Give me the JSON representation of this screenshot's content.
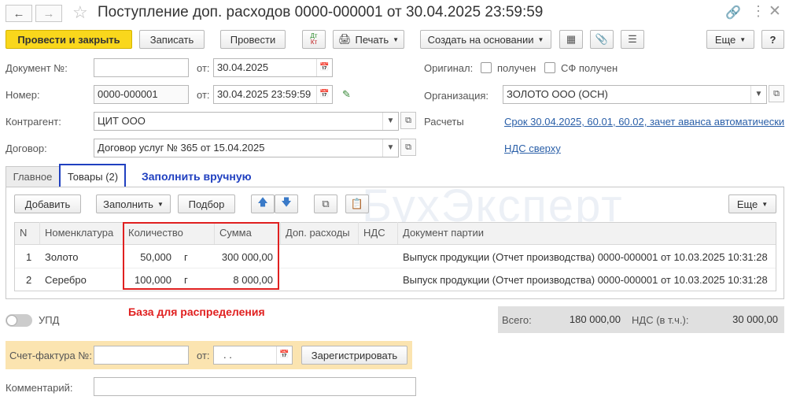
{
  "window": {
    "title": "Поступление доп. расходов 0000-000001 от 30.04.2025 23:59:59"
  },
  "toolbar": {
    "post_close": "Провести и закрыть",
    "save": "Записать",
    "post": "Провести",
    "dtkt_top": "Дт",
    "dtkt_bottom": "Кт",
    "print": "Печать",
    "create_based": "Создать на основании",
    "more": "Еще",
    "help": "?"
  },
  "form": {
    "doc_no_label": "Документ №:",
    "doc_no_value": "",
    "from_label": "от:",
    "doc_date": "30.04.2025",
    "number_label": "Номер:",
    "number_value": "0000-000001",
    "number_date": "30.04.2025 23:59:59",
    "original_label": "Оригинал:",
    "received_label": "получен",
    "sf_received_label": "СФ получен",
    "org_label": "Организация:",
    "org_value": "ЗОЛОТО ООО (ОСН)",
    "counterparty_label": "Контрагент:",
    "counterparty_value": "ЦИТ ООО",
    "settlements_label": "Расчеты",
    "settlements_link": "Срок 30.04.2025, 60.01, 60.02, зачет аванса автоматически",
    "contract_label": "Договор:",
    "contract_value": "Договор услуг № 365 от 15.04.2025",
    "vat_link": "НДС сверху"
  },
  "tabs": [
    {
      "label": "Главное"
    },
    {
      "label": "Товары (2)"
    }
  ],
  "goods": {
    "add": "Добавить",
    "fill": "Заполнить",
    "selection": "Подбор",
    "more": "Еще",
    "columns": [
      "N",
      "Номенклатура",
      "Количество",
      "Сумма",
      "Доп. расходы",
      "НДС",
      "Документ партии"
    ],
    "rows": [
      {
        "n": "1",
        "name": "Золото",
        "qty": "50,000",
        "unit": "г",
        "sum": "300 000,00",
        "extra": "",
        "vat": "",
        "doc": "Выпуск продукции (Отчет производства) 0000-000001 от 10.03.2025 10:31:28"
      },
      {
        "n": "2",
        "name": "Серебро",
        "qty": "100,000",
        "unit": "г",
        "sum": "8 000,00",
        "extra": "",
        "vat": "",
        "doc": "Выпуск продукции (Отчет производства) 0000-000001 от 10.03.2025 10:31:28"
      }
    ]
  },
  "annotations": {
    "fill_manually": "Заполнить вручную",
    "distribution_base": "База для распределения"
  },
  "watermark": "БухЭксперт",
  "footer": {
    "upd_label": "УПД",
    "total_label": "Всего:",
    "total_value": "180 000,00",
    "vat_label": "НДС (в т.ч.):",
    "vat_value": "30 000,00",
    "invoice_label": "Счет-фактура №:",
    "invoice_value": "",
    "invoice_from_label": "от:",
    "invoice_date": " .  .",
    "register": "Зарегистрировать",
    "comment_label": "Комментарий:",
    "comment_value": ""
  },
  "colors": {
    "accent_yellow": "#f9d71c",
    "link": "#2a5fa8",
    "annotation_red": "#e02020",
    "annotation_blue": "#2040c0",
    "invoice_bg": "#fbe4b0"
  }
}
